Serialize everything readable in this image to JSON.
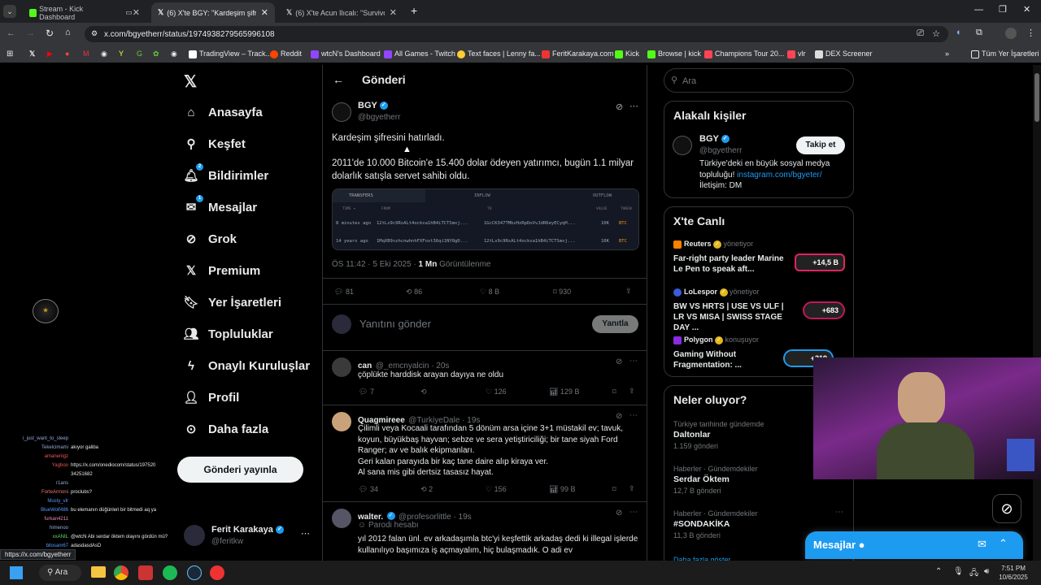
{
  "browser": {
    "tabs": [
      {
        "label": "Stream - Kick Dashboard"
      },
      {
        "label": "(6) X'te BGY: \"Kardeşim şifresini"
      },
      {
        "label": "(6) X'te Acun Ilıcalı: \"Survivor 20"
      }
    ],
    "url": "x.com/bgyetherr/status/1974938279565996108",
    "bookmarks": [
      "TradingView – Track...",
      "Reddit",
      "wtcN's Dashboard",
      "All Games - Twitch",
      "Text faces | Lenny fa...",
      "FeritKarakaya.com",
      "Kick",
      "Browse | kick",
      "Champions Tour 20...",
      "vlr",
      "DEX Screener"
    ],
    "all_bookmarks": "Tüm Yer İşaretleri",
    "status_url": "https://x.com/bgyetherr"
  },
  "nav": {
    "items": [
      {
        "label": "Anasayfa"
      },
      {
        "label": "Keşfet"
      },
      {
        "label": "Bildirimler",
        "badge": "2"
      },
      {
        "label": "Mesajlar",
        "badge": "1"
      },
      {
        "label": "Grok"
      },
      {
        "label": "Premium"
      },
      {
        "label": "Yer İşaretleri"
      },
      {
        "label": "Topluluklar"
      },
      {
        "label": "Onaylı Kuruluşlar"
      },
      {
        "label": "Profil"
      },
      {
        "label": "Daha fazla"
      }
    ],
    "post_button": "Gönderi yayınla",
    "account": {
      "name": "Ferit Karakaya",
      "handle": "@feritkw"
    }
  },
  "main": {
    "header": "Gönderi",
    "post": {
      "author": "BGY",
      "handle": "@bgyetherr",
      "text1": "Kardeşim şifresini hatırladı.",
      "text2": "2011'de 10.000 Bitcoin'e 15.400 dolar ödeyen yatırımcı, bugün 1.1 milyar dolarlık satışla servet sahibi oldu.",
      "image": {
        "tabs": [
          "TRANSFERS",
          "INFLOW",
          "OUTFLOW"
        ],
        "cols": [
          "TIME ▾",
          "FROM",
          "TO",
          "VALUE",
          "TOKEN"
        ],
        "rows": [
          {
            "time": "8 minutes ago",
            "from": "12tLs9c9RsALt4ockxa1hB4iTCTSmxj...",
            "to": "1GcCK347TMbzHzRpDoVvJdR6eyECyqH...",
            "value": "10K",
            "token": "BTC"
          },
          {
            "time": "14 years ago",
            "from": "1MqXB9szhcnwhnhFXFoxt36qi1NY8gD...",
            "to": "12tLs9c9RsALt4ockxa1hB4iTCTSmxj...",
            "value": "10K",
            "token": "BTC"
          }
        ]
      },
      "time": "ÖS 11:42 · 5 Eki 2025 · ",
      "views": "1 Mn",
      "views_label": " Görüntülenme",
      "stats": {
        "replies": "81",
        "reposts": "86",
        "likes": "8 B",
        "bookmarks": "930"
      }
    },
    "reply_box": {
      "placeholder": "Yanıtını gönder",
      "button": "Yanıtla"
    },
    "replies": [
      {
        "name": "can",
        "handle": "@_emcnyalcin · 20s",
        "text": "çöplükte harddisk arayan dayıya ne oldu",
        "stats": {
          "replies": "7",
          "reposts": "",
          "likes": "126",
          "views": "129 B"
        }
      },
      {
        "name": "Quagmireee",
        "handle": "@TurkiyeDale · 19s",
        "text": "Çilimli veya Kocaali tarafından 5 dönüm arsa içine 3+1 müstakil ev; tavuk, koyun, büyükbaş hayvan; sebze ve sera yetiştiriciliği; bir tane siyah Ford Ranger; av ve balık ekipmanları.\nGeri kalan parayıda bir kaç tane daire alıp kiraya ver.\nAl sana mis gibi dertsiz tasasız hayat.",
        "stats": {
          "replies": "34",
          "reposts": "2",
          "likes": "156",
          "views": "99 B"
        }
      },
      {
        "name": "walter.",
        "handle": "@profesorlittle · 19s",
        "sub": "Parodi hesabı",
        "text": "yıl 2012 falan ünl. ev arkadaşımla btc'yi keşfettik arkadaş dedi ki illegal işlerde kullanılıyo başımıza iş açmayalım, hiç bulaşmadık. O adi ev"
      }
    ]
  },
  "right": {
    "search_placeholder": "Ara",
    "related": {
      "title": "Alakalı kişiler",
      "name": "BGY",
      "handle": "@bgyetherr",
      "follow": "Takip et",
      "bio": "Türkiye'deki en büyük sosyal medya topluluğu! ",
      "bio_link": "instagram.com/bgyeter/",
      "bio2": "İletişim: DM"
    },
    "live": {
      "title": "X'te Canlı",
      "items": [
        {
          "host": "Reuters",
          "status": "yönetiyor",
          "title": "Far-right party leader Marine Le Pen to speak aft...",
          "count": "+14,5 B"
        },
        {
          "host": "LoLespor",
          "status": "yönetiyor",
          "title": "BW VS HRTS | USE VS ULF | LR VS MISA | SWISS STAGE DAY ...",
          "count": "+683"
        },
        {
          "host": "Polygon",
          "status": "konuşuyor",
          "title": "Gaming Without Fragmentation: ...",
          "count": "+319"
        }
      ]
    },
    "trends": {
      "title": "Neler oluyor?",
      "items": [
        {
          "context": "Türkiye tarihinde gündemde",
          "name": "Daltonlar",
          "count": "1.159 gönderi"
        },
        {
          "context": "Haberler · Gündemdekiler",
          "name": "Serdar Öktem",
          "count": "12,7 B gönderi"
        },
        {
          "context": "Haberler · Gündemdekiler",
          "name": "#SONDAKİKA",
          "count": "11,3 B gönderi"
        }
      ],
      "more": "Daha fazla göster"
    },
    "messages": "Mesajlar"
  },
  "stream_chat": [
    {
      "user": "i_just_want_to_sleep",
      "msg": ""
    },
    {
      "user": "Tekelcimami",
      "msg": "akıyor galiba"
    },
    {
      "user": "amaneriigz",
      "msg": ""
    },
    {
      "user": "Yagboo",
      "msg": "https://x.com/onediocom/status/197520"
    },
    {
      "user": "",
      "msg": "34251682"
    },
    {
      "user": "r1ans",
      "msg": ""
    },
    {
      "user": "ForteArmoni",
      "msg": "proclubs?"
    },
    {
      "user": "Musty_vlr",
      "msg": ""
    },
    {
      "user": "BlueWolf486",
      "msg": "bu elemanın düğünleri bir bitmedi aq ya"
    },
    {
      "user": "furkan4211",
      "msg": ""
    },
    {
      "user": "himenoo",
      "msg": ""
    },
    {
      "user": "xxANIL",
      "msg": "@wtcN Abi serdar öktem olayını gördün mü?"
    },
    {
      "user": "bilosam67",
      "msg": "adasdasdAsD"
    }
  ],
  "taskbar": {
    "search": "Ara",
    "time": "7:51 PM",
    "date": "10/6/2025"
  }
}
